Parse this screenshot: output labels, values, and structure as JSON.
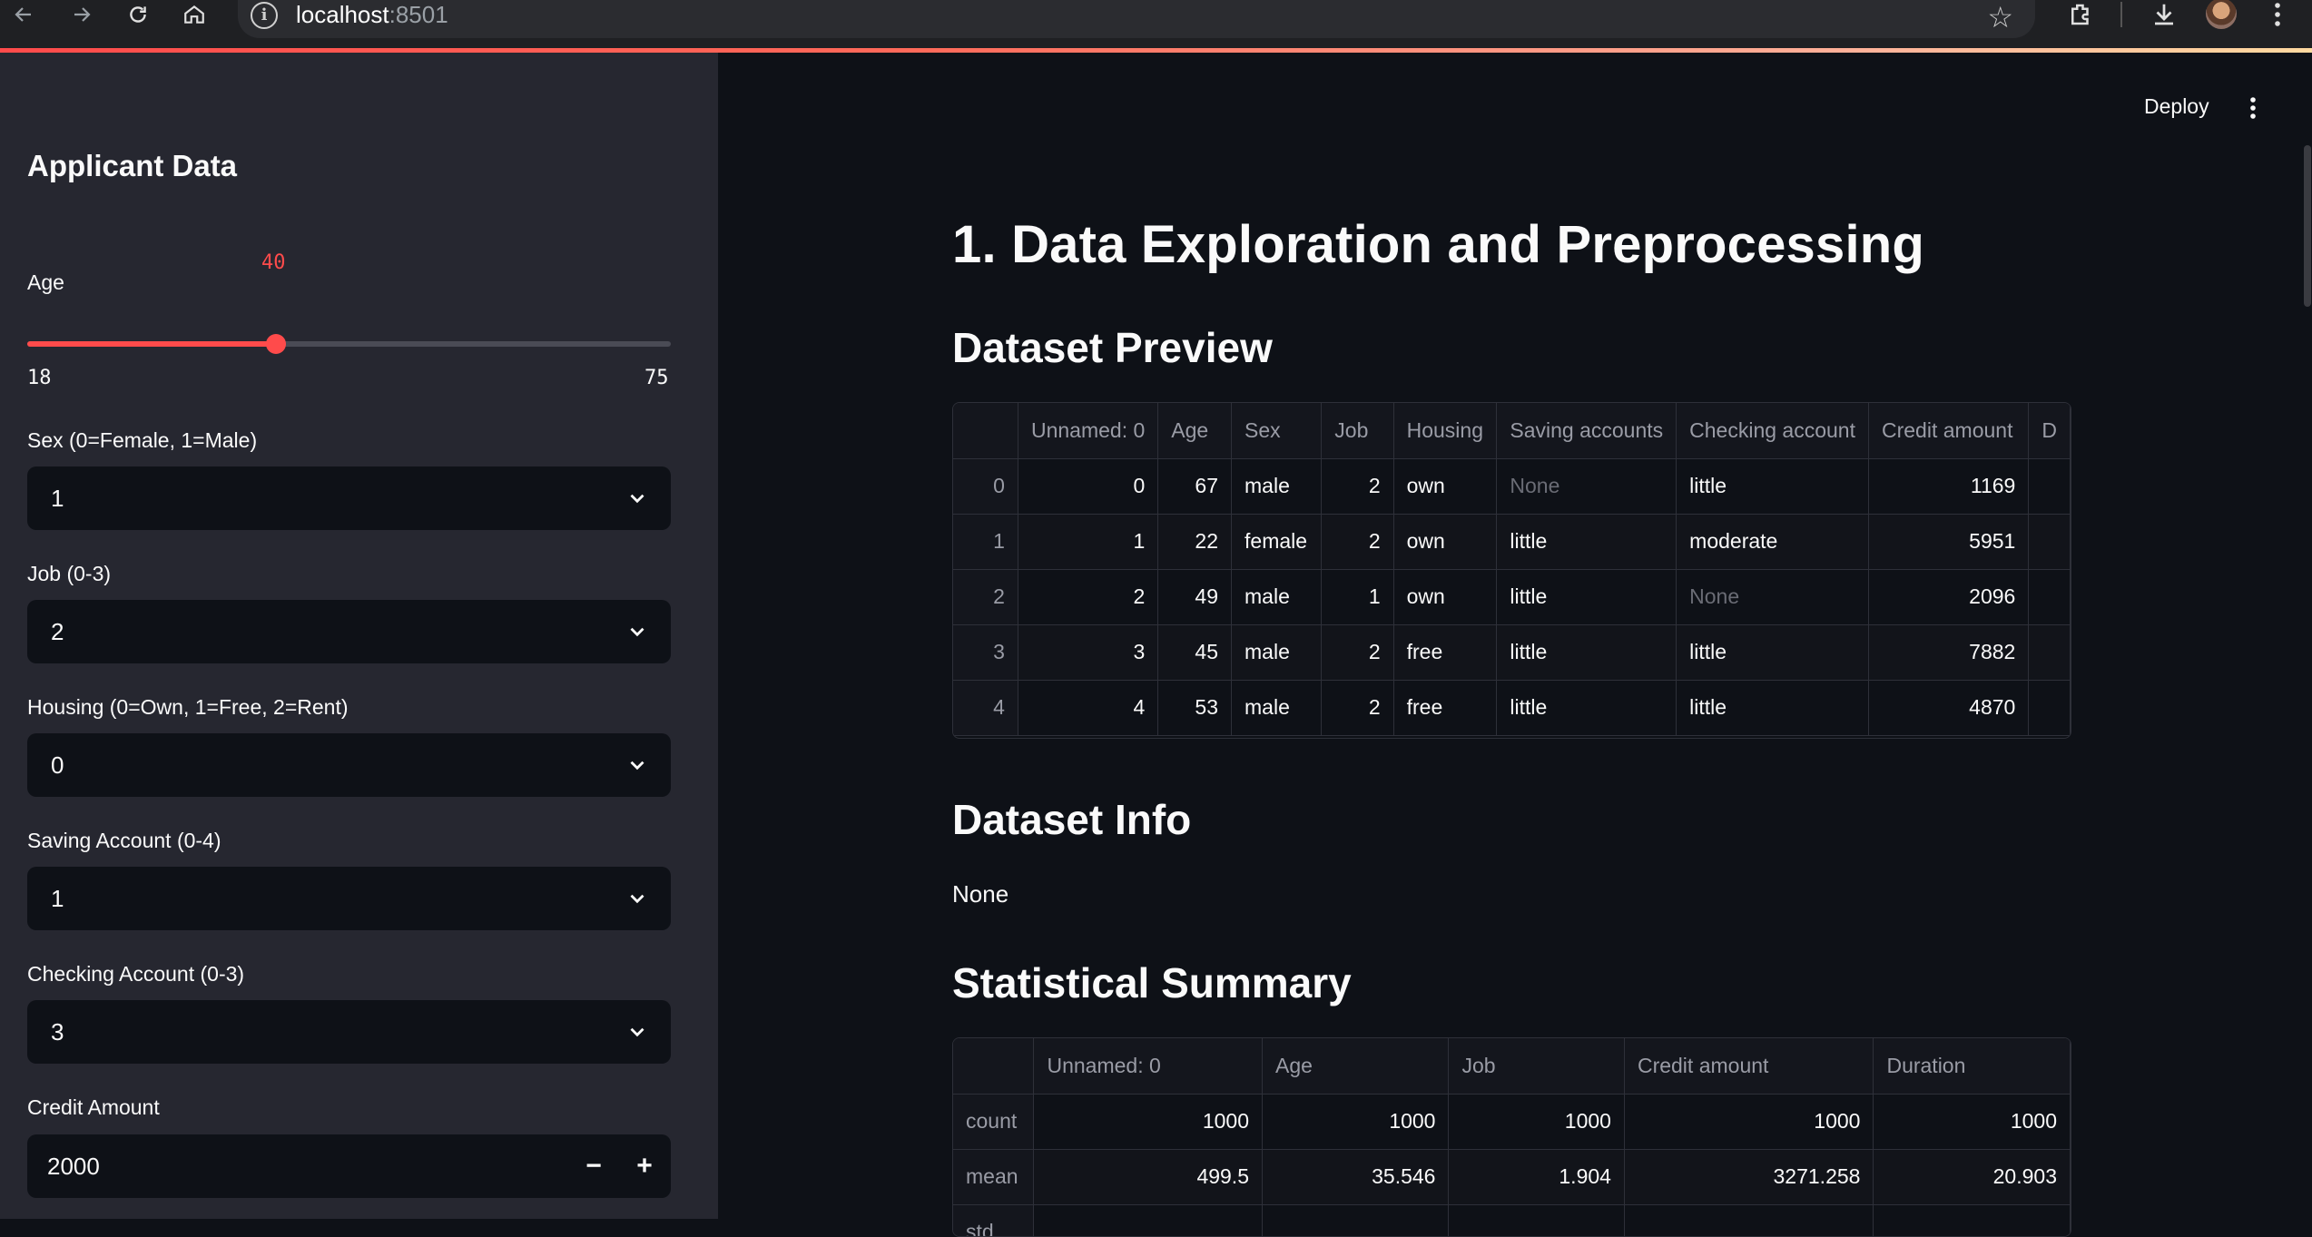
{
  "browser": {
    "url_host": "localhost",
    "url_port": ":8501"
  },
  "toolbar": {
    "deploy_label": "Deploy"
  },
  "sidebar": {
    "title": "Applicant Data",
    "age": {
      "label": "Age",
      "value": "40",
      "min": "18",
      "max": "75",
      "fraction": 0.386
    },
    "sex": {
      "label": "Sex (0=Female, 1=Male)",
      "value": "1"
    },
    "job": {
      "label": "Job (0-3)",
      "value": "2"
    },
    "housing": {
      "label": "Housing (0=Own, 1=Free, 2=Rent)",
      "value": "0"
    },
    "saving": {
      "label": "Saving Account (0-4)",
      "value": "1"
    },
    "checking": {
      "label": "Checking Account (0-3)",
      "value": "3"
    },
    "credit": {
      "label": "Credit Amount",
      "value": "2000",
      "minus": "−",
      "plus": "+"
    }
  },
  "main": {
    "title": "1. Data Exploration and Preprocessing",
    "preview_heading": "Dataset Preview",
    "info_heading": "Dataset Info",
    "info_text": "None",
    "summary_heading": "Statistical Summary"
  },
  "preview_table": {
    "columns": [
      "",
      "Unnamed: 0",
      "Age",
      "Sex",
      "Job",
      "Housing",
      "Saving accounts",
      "Checking account",
      "Credit amount",
      "D"
    ],
    "rows": [
      [
        "0",
        "0",
        "67",
        "male",
        "2",
        "own",
        "None",
        "little",
        "1169"
      ],
      [
        "1",
        "1",
        "22",
        "female",
        "2",
        "own",
        "little",
        "moderate",
        "5951"
      ],
      [
        "2",
        "2",
        "49",
        "male",
        "1",
        "own",
        "little",
        "None",
        "2096"
      ],
      [
        "3",
        "3",
        "45",
        "male",
        "2",
        "free",
        "little",
        "little",
        "7882"
      ],
      [
        "4",
        "4",
        "53",
        "male",
        "2",
        "free",
        "little",
        "little",
        "4870"
      ]
    ]
  },
  "summary_table": {
    "columns": [
      "",
      "Unnamed: 0",
      "Age",
      "Job",
      "Credit amount",
      "Duration"
    ],
    "rows": [
      [
        "count",
        "1000",
        "1000",
        "1000",
        "1000",
        "1000"
      ],
      [
        "mean",
        "499.5",
        "35.546",
        "1.904",
        "3271.258",
        "20.903"
      ],
      [
        "std",
        "",
        "",
        "",
        "",
        ""
      ]
    ]
  }
}
